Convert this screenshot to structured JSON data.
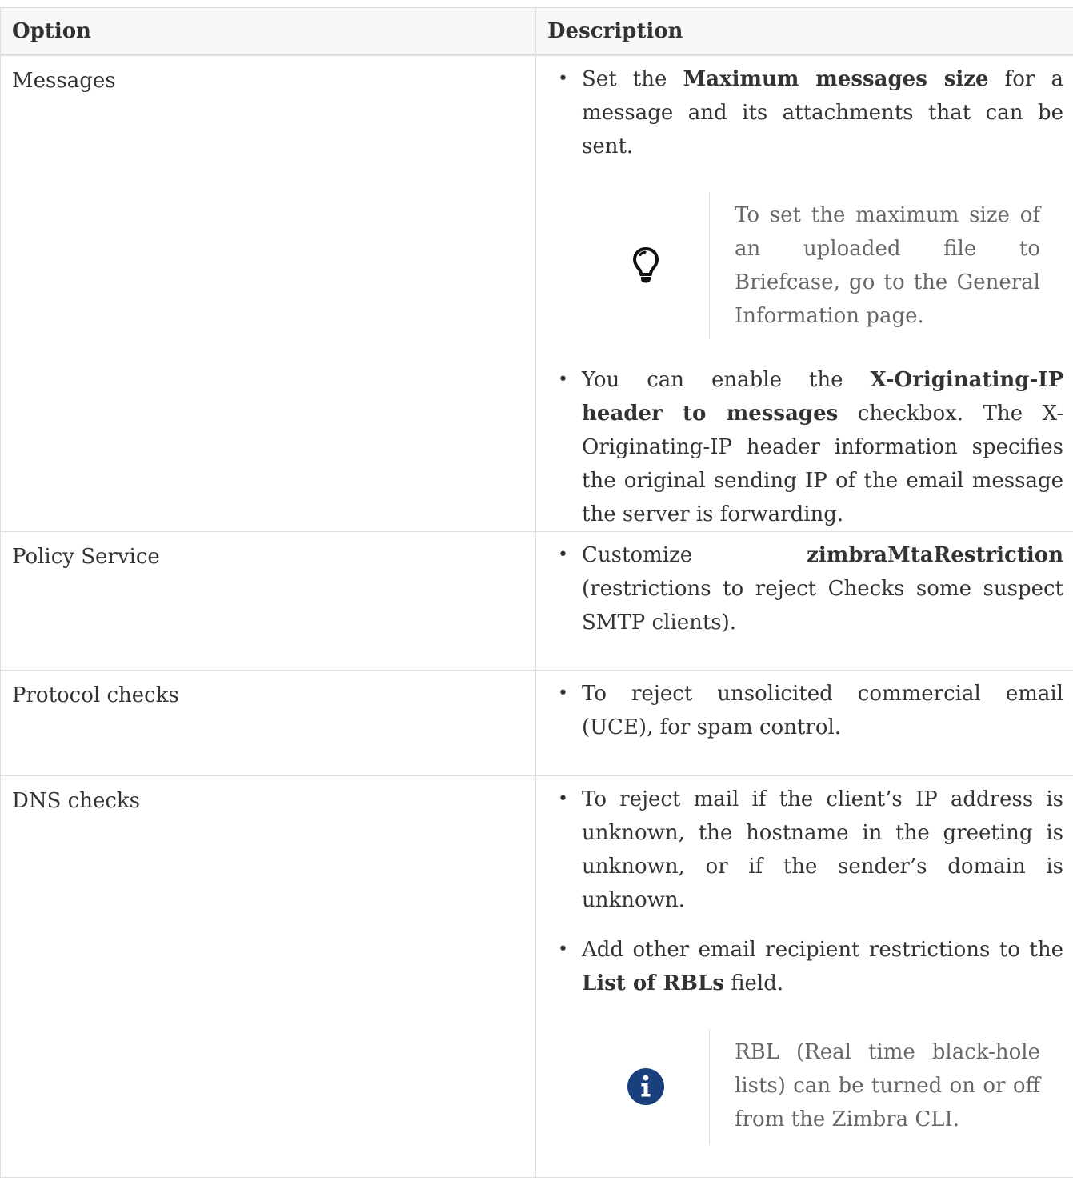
{
  "table": {
    "headers": {
      "option": "Option",
      "description": "Description"
    },
    "rows": [
      {
        "option": "Messages",
        "bullet1": {
          "pre": "Set the ",
          "bold": "Maximum messages size",
          "post": " for a message and its attachments that can be sent."
        },
        "tip": {
          "icon": "lightbulb-icon",
          "text": "To set the maximum size of an uploaded file to Briefcase, go to the General Information page."
        },
        "bullet2": {
          "pre": "You can enable the ",
          "bold": "X-Originating-IP header to messages",
          "post": " checkbox. The X-Originating-IP header information specifies the original sending IP of the email message the server is forwarding."
        }
      },
      {
        "option": "Policy Service",
        "bullet1": {
          "pre": "Customize ",
          "bold": "zimbraMtaRestriction",
          "post": " (restrictions to reject Checks some suspect SMTP clients)."
        }
      },
      {
        "option": "Protocol checks",
        "bullet1": {
          "text": "To reject unsolicited commercial email (UCE), for spam control."
        }
      },
      {
        "option": "DNS checks",
        "bullet1": {
          "text": "To reject mail if the client’s IP address is unknown, the hostname in the greeting is unknown, or if the sender’s domain is unknown."
        },
        "bullet2": {
          "pre": "Add other email recipient restrictions to the ",
          "bold": "List of RBLs",
          "post": " field."
        },
        "note": {
          "icon": "info-icon",
          "text": "RBL (Real time black-hole lists) can be turned on or off from the Zimbra CLI."
        }
      }
    ]
  },
  "colors": {
    "border": "#dedede",
    "header_bg": "#f7f8f7",
    "info_icon": "#19407c",
    "tip_icon": "#111111"
  }
}
